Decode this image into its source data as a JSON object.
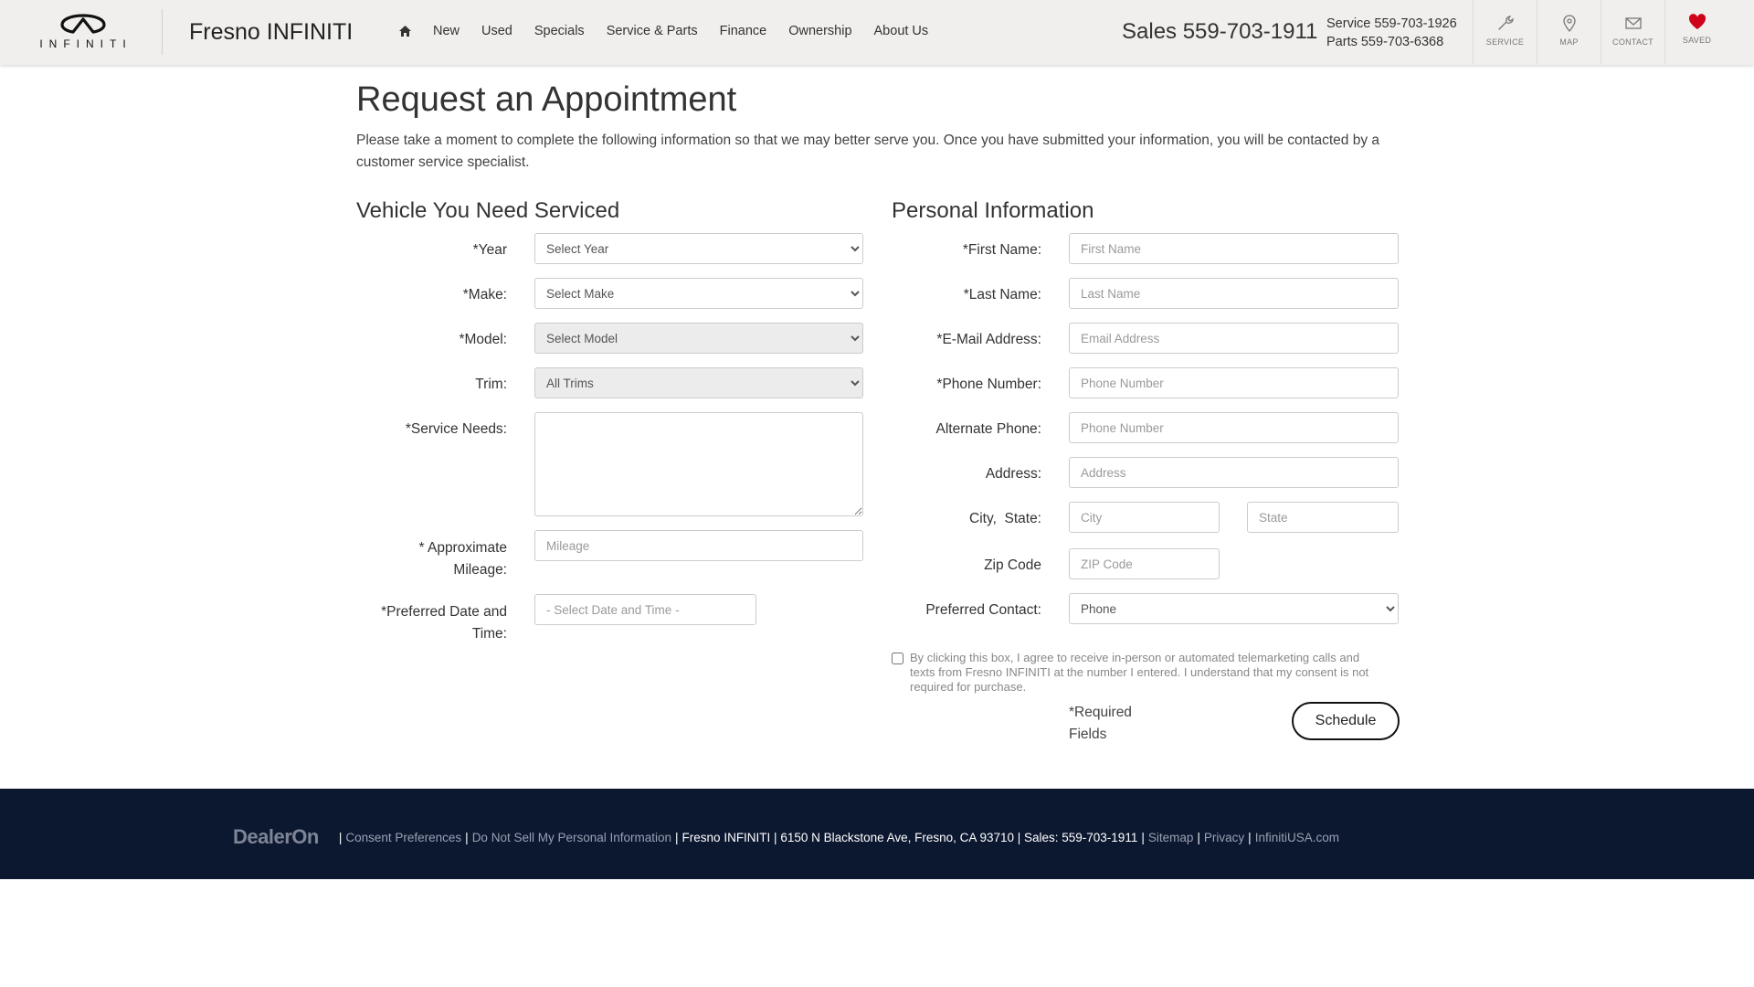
{
  "header": {
    "logo_text": "INFINITI",
    "dealer_name": "Fresno INFINITI",
    "nav": [
      "New",
      "Used",
      "Specials",
      "Service & Parts",
      "Finance",
      "Ownership",
      "About Us"
    ],
    "sales_phone": "Sales 559-703-1911",
    "service_phone": "Service 559-703-1926",
    "parts_phone": "Parts 559-703-6368",
    "utility": {
      "service": "SERVICE",
      "map": "MAP",
      "contact": "CONTACT",
      "saved": "SAVED"
    },
    "saved_color": "#d0021b"
  },
  "page": {
    "title": "Request an Appointment",
    "intro": "Please take a moment to complete the following information so that we may better serve you. Once you have submitted your information, you will be contacted by a customer service specialist."
  },
  "vehicle": {
    "title": "Vehicle You Need Serviced",
    "year_label": "*Year",
    "year_value": "Select Year",
    "make_label": "*Make:",
    "make_value": "Select Make",
    "model_label": "*Model:",
    "model_value": "Select Model",
    "trim_label": "Trim:",
    "trim_value": "All Trims",
    "service_needs_label": "*Service Needs:",
    "mileage_label_1": "* Approximate",
    "mileage_label_2": "Mileage:",
    "mileage_placeholder": "Mileage",
    "date_label_1": "*Preferred Date and",
    "date_label_2": "Time:",
    "date_placeholder": "- Select Date and Time -"
  },
  "personal": {
    "title": "Personal Information",
    "first_name_label": "*First Name:",
    "first_name_placeholder": "First Name",
    "last_name_label": "*Last Name:",
    "last_name_placeholder": "Last Name",
    "email_label": "*E-Mail Address:",
    "email_placeholder": "Email Address",
    "phone_label": "*Phone Number:",
    "phone_placeholder": "Phone Number",
    "alt_phone_label": "Alternate Phone:",
    "alt_phone_placeholder": "Phone Number",
    "address_label": "Address:",
    "address_placeholder": "Address",
    "city_state_label": "City,  State:",
    "city_placeholder": "City",
    "state_placeholder": "State",
    "zip_label": "Zip Code",
    "zip_placeholder": "ZIP Code",
    "preferred_contact_label": "Preferred Contact:",
    "preferred_contact_value": "Phone",
    "consent_text": "By clicking this box, I agree to receive in-person or automated telemarketing calls and texts from Fresno INFINITI at the number I entered. I understand that my consent is not required for purchase.",
    "required_text": "*Required Fields",
    "schedule_label": "Schedule"
  },
  "footer": {
    "dealeron": "DealerOn",
    "consent_prefs": "Consent Preferences",
    "do_not_sell": "Do Not Sell My Personal Information",
    "dealer_info": "Fresno INFINITI | 6150 N Blackstone Ave, Fresno, CA 93710 | Sales: 559-703-1911",
    "sitemap": "Sitemap",
    "privacy": "Privacy",
    "infiniti_usa": "InfinitiUSA.com",
    "background": "#0c1730"
  }
}
